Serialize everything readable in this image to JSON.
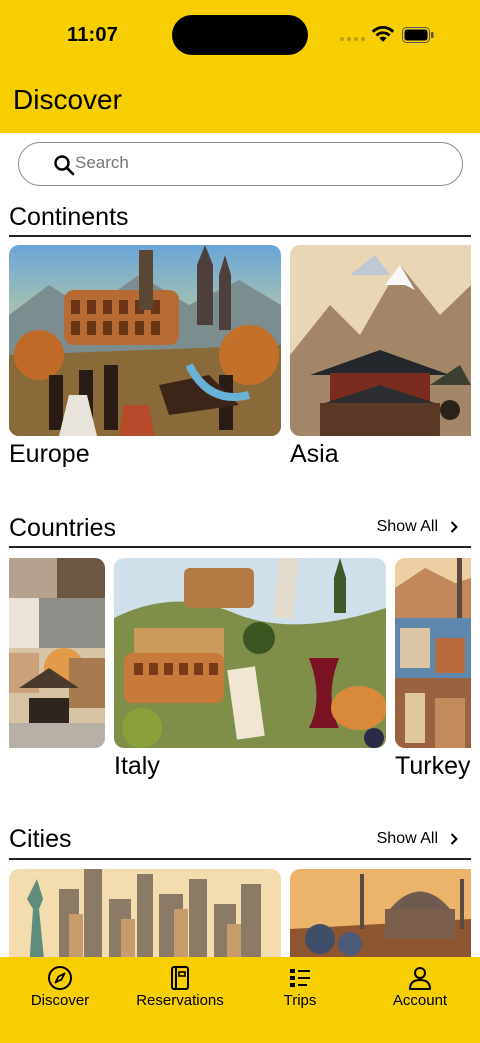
{
  "status": {
    "time": "11:07"
  },
  "header": {
    "title": "Discover"
  },
  "search": {
    "placeholder": "Search"
  },
  "sections": {
    "continents": {
      "title": "Continents",
      "items": [
        {
          "label": "Europe"
        },
        {
          "label": "Asia"
        }
      ]
    },
    "countries": {
      "title": "Countries",
      "show_all": "Show All",
      "items": [
        {
          "label": ""
        },
        {
          "label": "Italy"
        },
        {
          "label": "Turkey"
        }
      ]
    },
    "cities": {
      "title": "Cities",
      "show_all": "Show All"
    }
  },
  "tabbar": {
    "items": [
      {
        "label": "Discover",
        "icon": "compass-icon"
      },
      {
        "label": "Reservations",
        "icon": "notebook-icon"
      },
      {
        "label": "Trips",
        "icon": "list-icon"
      },
      {
        "label": "Account",
        "icon": "person-icon"
      }
    ]
  },
  "colors": {
    "accent": "#F7CE00"
  }
}
